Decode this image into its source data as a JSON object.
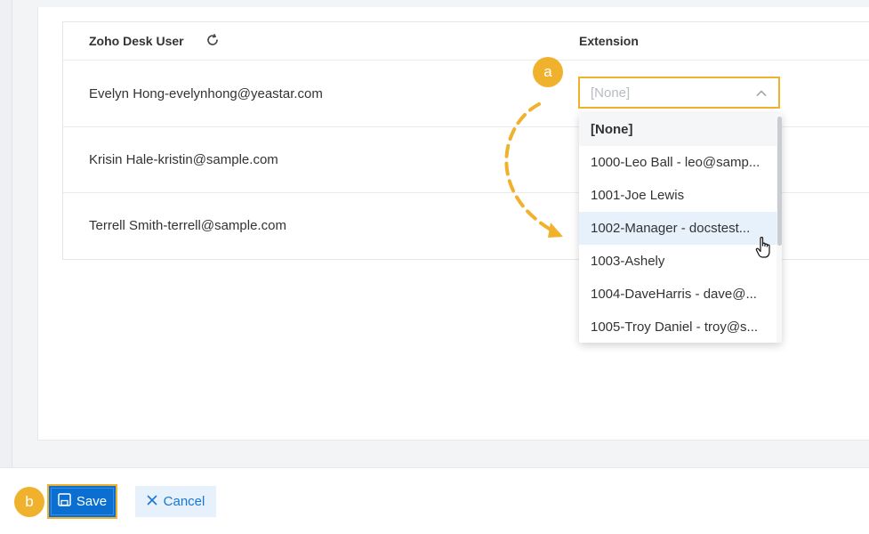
{
  "table": {
    "headers": {
      "user": "Zoho Desk User",
      "extension": "Extension"
    },
    "rows": [
      {
        "user": "Evelyn Hong-evelynhong@yeastar.com"
      },
      {
        "user": "Krisin Hale-kristin@sample.com"
      },
      {
        "user": "Terrell Smith-terrell@sample.com"
      }
    ]
  },
  "select": {
    "value": "[None]"
  },
  "dropdown": {
    "options": [
      "[None]",
      "1000-Leo Ball - leo@samp...",
      "1001-Joe Lewis",
      "1002-Manager - docstest...",
      "1003-Ashely",
      "1004-DaveHarris - dave@...",
      "1005-Troy Daniel - troy@s..."
    ]
  },
  "callouts": {
    "a": "a",
    "b": "b"
  },
  "footer": {
    "save_label": "Save",
    "cancel_label": "Cancel"
  },
  "colors": {
    "accent": "#f0b12d",
    "primary": "#0a6fd0",
    "hover": "#e6f1fb"
  },
  "icons": {
    "refresh": "refresh-icon",
    "chevron": "chevron-up-icon",
    "save": "save-icon",
    "cancel": "close-icon",
    "cursor": "hand-cursor-icon"
  }
}
